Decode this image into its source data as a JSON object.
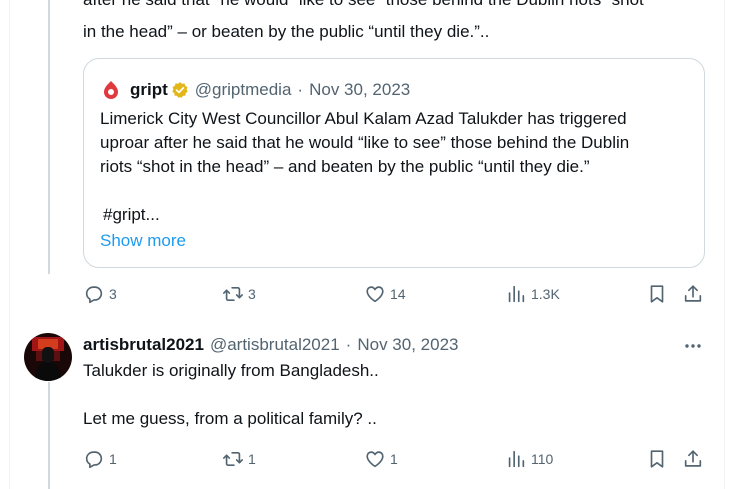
{
  "previous_tweet": {
    "text_cut_line": "after he said that \"he would “like to see” those behind the Dublin riots “shot",
    "text_last_line": "in the head” –  or beaten by the public “until they die.”.."
  },
  "quote": {
    "name": "gript",
    "handle": "@griptmedia",
    "separator": "·",
    "date": "Nov 30, 2023",
    "lines": [
      "Limerick City West Councillor Abul Kalam Azad Talukder has triggered",
      "uproar after he said that he would “like to see” those behind the Dublin",
      "riots “shot in the head” – and beaten by the public “until they die.”"
    ],
    "hashtag_line": "#gript...",
    "show_more": "Show more",
    "verified_color": "#e2b719",
    "logo_color": "#e0393e"
  },
  "actions_1": {
    "replies": "3",
    "reposts": "3",
    "likes": "14",
    "views": "1.3K"
  },
  "reply": {
    "name": "artisbrutal2021",
    "handle": "@artisbrutal2021",
    "separator": "·",
    "date": "Nov 30, 2023",
    "line1": "Talukder is originally from Bangladesh..",
    "line2": "Let me guess, from a political family? .."
  },
  "actions_2": {
    "replies": "1",
    "reposts": "1",
    "likes": "1",
    "views": "110"
  },
  "icons": {
    "reply": "reply-icon",
    "repost": "repost-icon",
    "like": "heart-icon",
    "views": "views-icon",
    "bookmark": "bookmark-icon",
    "share": "share-icon",
    "more": "more-dots-icon"
  },
  "colors": {
    "link": "#1d9bf0",
    "secondary": "#536471",
    "border": "#cfd9de"
  }
}
